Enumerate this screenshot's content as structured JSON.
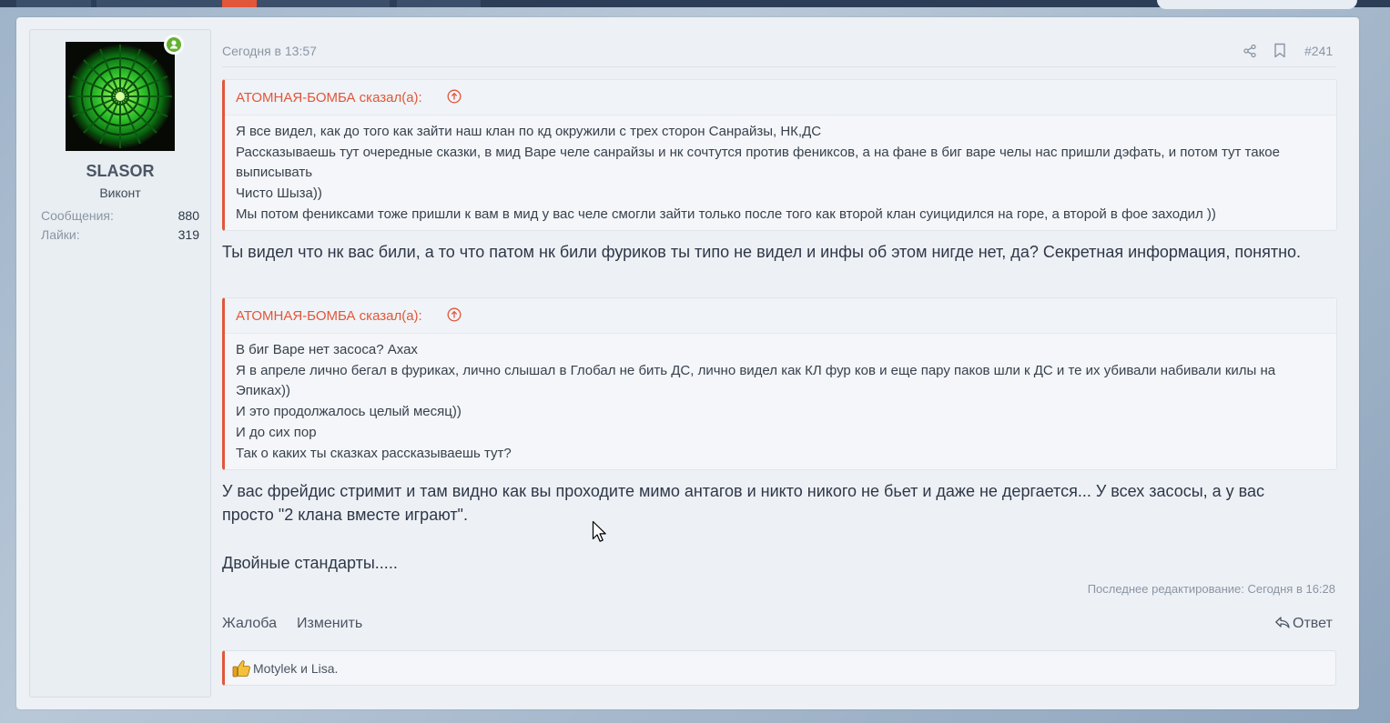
{
  "user": {
    "name": "SLASOR",
    "title": "Виконт",
    "stats": [
      {
        "label": "Сообщения:",
        "value": "880"
      },
      {
        "label": "Лайки:",
        "value": "319"
      }
    ]
  },
  "post": {
    "date": "Сегодня в 13:57",
    "number": "#241",
    "quotes": [
      {
        "author": "АТОМНАЯ-БОМБА сказал(а):",
        "lines": [
          "Я все видел, как до того как зайти наш клан по кд окружили с трех сторон Санрайзы, НК,ДС",
          "Рассказываешь тут очередные сказки, в мид Варе челе санрайзы и нк сочтутся против фениксов, а на фане в биг варе челы нас пришли дэфать, и потом тут такое выписывать",
          "Чисто Шыза))",
          "Мы потом фениксами тоже пришли к вам в мид у вас челе смогли зайти только после того как второй клан суицидился на горе, а второй в фое заходил ))"
        ]
      },
      {
        "author": "АТОМНАЯ-БОМБА сказал(а):",
        "lines": [
          "В биг Варе нет засоса? Ахах",
          "Я в апреле лично бегал в фуриках, лично слышал в Глобал не бить ДС, лично видел как КЛ фур ков и еще пару паков шли к ДС и те их убивали набивали килы на Эпиках))",
          "И это продолжалось целый месяц))",
          "И до сих пор",
          "Так о каких ты сказках рассказываешь тут?"
        ]
      }
    ],
    "reply1": "Ты видел что нк вас били, а то что патом нк били фуриков ты типо не видел и инфы об этом нигде нет, да? Секретная информация, понятно.",
    "reply2": "У вас фрейдис стримит и там видно как вы проходите мимо антагов и никто никого не бьет и даже не дергается... У всех засосы, а у вас просто \"2 клана вместе играют\".",
    "reply3": "Двойные стандарты.....",
    "last_edit": "Последнее редактирование: Сегодня в 16:28",
    "actions": {
      "report": "Жалоба",
      "edit": "Изменить",
      "reply": "Ответ"
    },
    "likes_text": "Motylek и Lisa."
  },
  "colors": {
    "accent": "#e0573a",
    "online": "#63b132"
  }
}
